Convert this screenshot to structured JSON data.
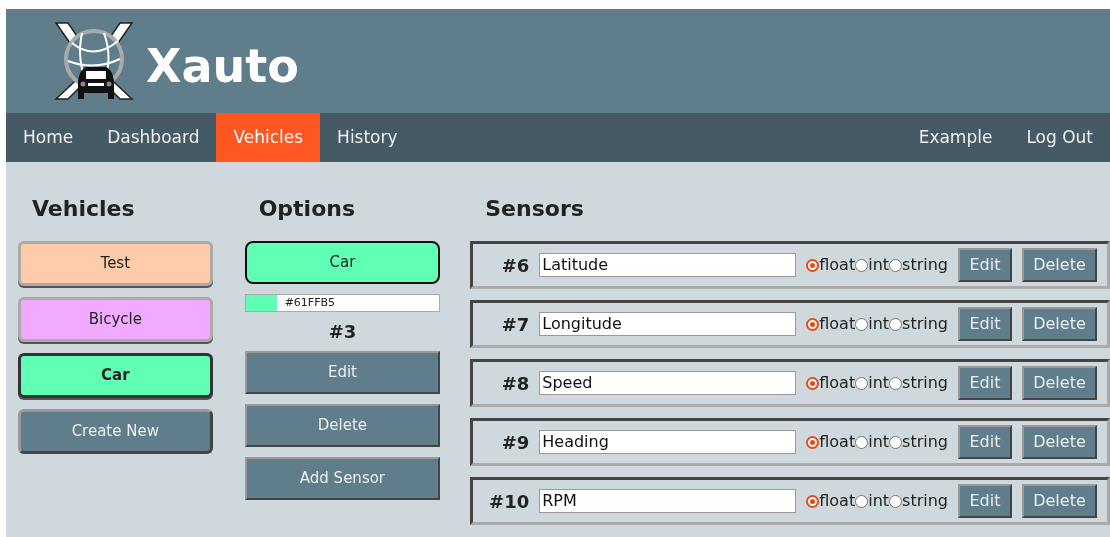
{
  "brand": {
    "title": "Xauto"
  },
  "nav": {
    "left": [
      {
        "label": "Home",
        "selected": false
      },
      {
        "label": "Dashboard",
        "selected": false
      },
      {
        "label": "Vehicles",
        "selected": true
      },
      {
        "label": "History",
        "selected": false
      }
    ],
    "right": [
      {
        "label": "Example",
        "selected": false
      },
      {
        "label": "Log Out",
        "selected": false
      }
    ]
  },
  "vehicles": {
    "title": "Vehicles",
    "items": [
      {
        "label": "Test",
        "color": "#ffccaa",
        "selected": false
      },
      {
        "label": "Bicycle",
        "color": "#f0aaff",
        "selected": false
      },
      {
        "label": "Car",
        "color": "#61ffb5",
        "selected": true
      }
    ],
    "create_button": "Create New"
  },
  "options": {
    "title": "Options",
    "name": "Car",
    "color": "#61ffb5",
    "color_value": "#61FFB5",
    "number": "#3",
    "buttons": [
      "Edit",
      "Delete",
      "Add Sensor"
    ]
  },
  "sensors": {
    "title": "Sensors",
    "rows": [
      {
        "number": "#6",
        "name": "Latitude",
        "types": [
          {
            "label": "float",
            "selected": true
          },
          {
            "label": "int",
            "selected": false
          },
          {
            "label": "string",
            "selected": false
          }
        ],
        "buttons": [
          "Edit",
          "Delete"
        ]
      },
      {
        "number": "#7",
        "name": "Longitude",
        "types": [
          {
            "label": "float",
            "selected": true
          },
          {
            "label": "int",
            "selected": false
          },
          {
            "label": "string",
            "selected": false
          }
        ],
        "buttons": [
          "Edit",
          "Delete"
        ]
      },
      {
        "number": "#8",
        "name": "Speed",
        "types": [
          {
            "label": "float",
            "selected": true
          },
          {
            "label": "int",
            "selected": false
          },
          {
            "label": "string",
            "selected": false
          }
        ],
        "buttons": [
          "Edit",
          "Delete"
        ]
      },
      {
        "number": "#9",
        "name": "Heading",
        "types": [
          {
            "label": "float",
            "selected": true
          },
          {
            "label": "int",
            "selected": false
          },
          {
            "label": "string",
            "selected": false
          }
        ],
        "buttons": [
          "Edit",
          "Delete"
        ]
      },
      {
        "number": "#10",
        "name": "RPM",
        "types": [
          {
            "label": "float",
            "selected": true
          },
          {
            "label": "int",
            "selected": false
          },
          {
            "label": "string",
            "selected": false
          }
        ],
        "buttons": [
          "Edit",
          "Delete"
        ]
      }
    ]
  }
}
